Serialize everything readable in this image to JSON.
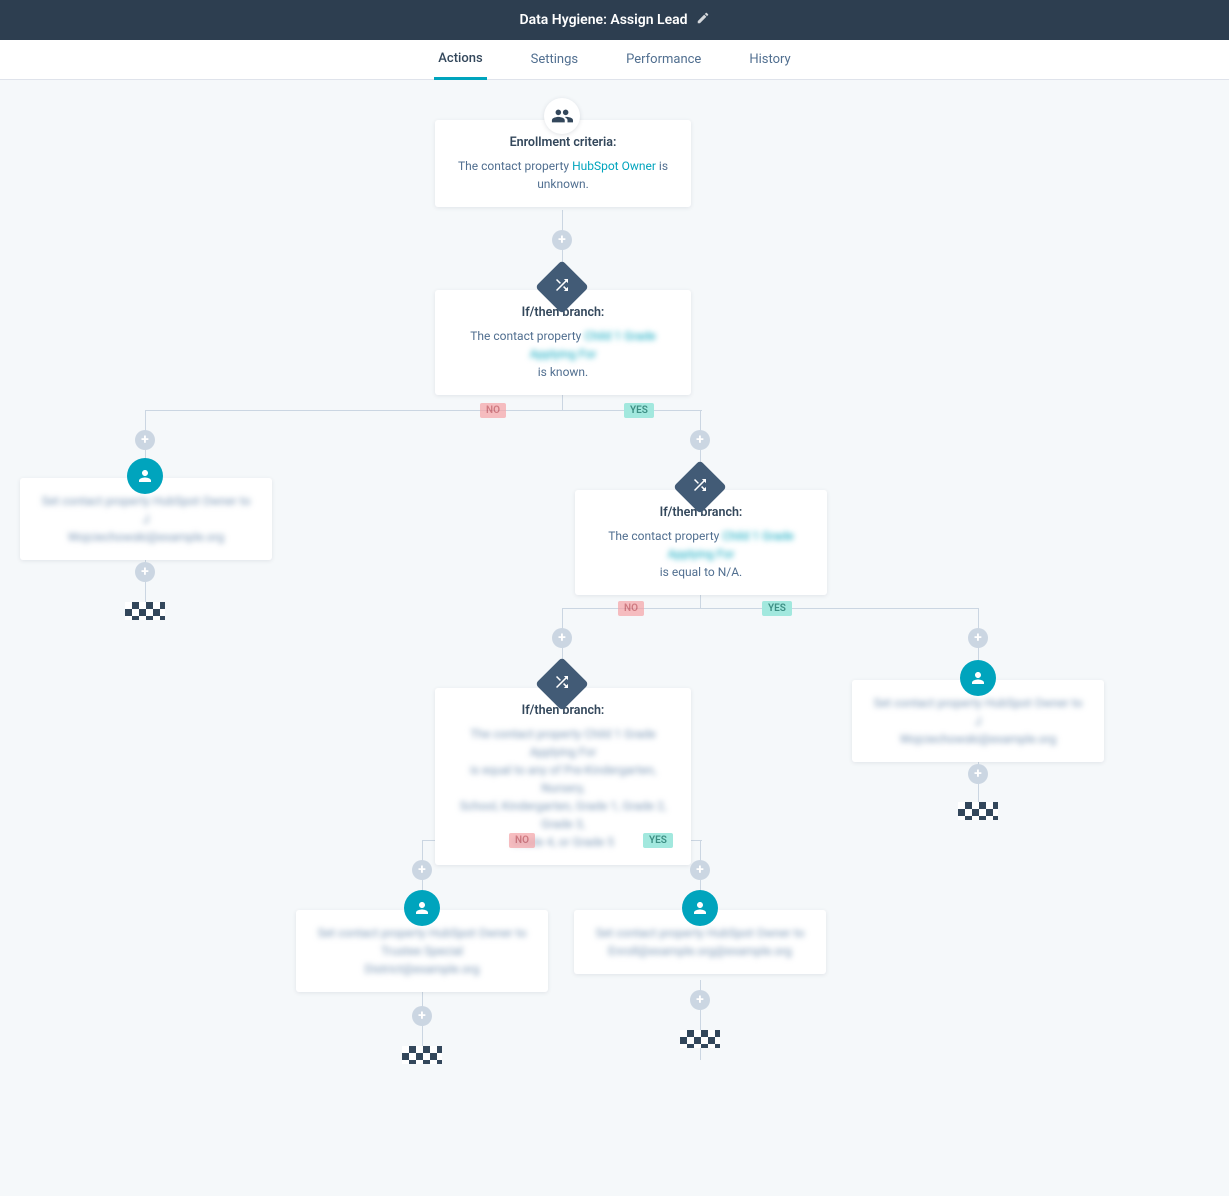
{
  "header": {
    "title": "Data Hygiene: Assign Lead"
  },
  "tabs": {
    "actions": "Actions",
    "settings": "Settings",
    "performance": "Performance",
    "history": "History"
  },
  "enroll": {
    "title": "Enrollment criteria:",
    "prefix": "The contact property ",
    "link": "HubSpot Owner",
    "suffix": " is unknown."
  },
  "branch1": {
    "title": "If/then branch:",
    "prefix": "The contact property ",
    "blurred": "Child 1 Grade Applying For",
    "suffix": "is known."
  },
  "branch2": {
    "title": "If/then branch:",
    "prefix": "The contact property ",
    "blurred": "Child 1 Grade Applying For",
    "suffix": "is equal to N/A."
  },
  "branch3": {
    "title": "If/then branch:",
    "line1": "The contact property Child 1 Grade Applying For",
    "line2": "is equal to any of Pre-Kindergarten, Nursery,",
    "line3": "School, Kindergarten, Grade 1, Grade 2, Grade 3,",
    "line4": "Grade 4, or Grade 5"
  },
  "actionA": {
    "line1": "Set contact property HubSpot Owner to J",
    "line2": "Wojciechowski@example.org"
  },
  "actionB": {
    "line1": "Set contact property HubSpot Owner to J",
    "line2": "Wojciechowski@example.org"
  },
  "actionC": {
    "line1": "Set contact property HubSpot Owner to",
    "line2": "Trustee Special",
    "line3": "District@example.org"
  },
  "actionD": {
    "line1": "Set contact property HubSpot Owner to",
    "line2": "Enroll@example.org@example.org"
  },
  "labels": {
    "yes": "YES",
    "no": "NO"
  }
}
